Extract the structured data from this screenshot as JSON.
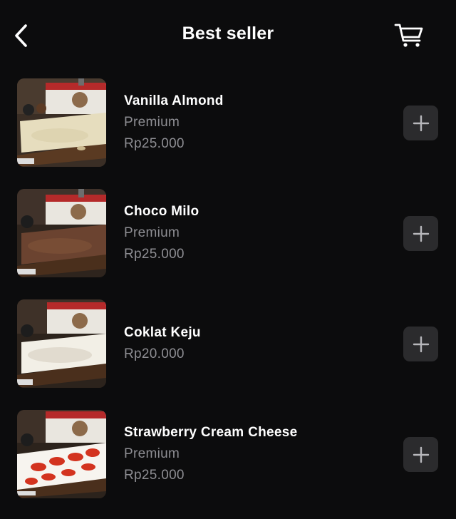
{
  "header": {
    "title": "Best seller",
    "back_icon": "chevron-left-icon",
    "cart_icon": "cart-icon"
  },
  "products": [
    {
      "name": "Vanilla Almond",
      "category": "Premium",
      "price": "Rp25.000",
      "topping_color": "#e6ddbe",
      "image_label": "almond"
    },
    {
      "name": "Choco Milo",
      "category": "Premium",
      "price": "Rp25.000",
      "topping_color": "#6b4330",
      "image_label": "choco"
    },
    {
      "name": "Coklat Keju",
      "price": "Rp20.000",
      "topping_color": "#f2efe6",
      "image_label": "keju"
    },
    {
      "name": "Strawberry Cream Cheese",
      "category": "Premium",
      "price": "Rp25.000",
      "topping_color": "#f7f4ef",
      "image_label": "strawberry"
    }
  ],
  "colors": {
    "background": "#0c0c0d",
    "button_bg": "#2b2b2d",
    "secondary_text": "#8e8e93"
  }
}
